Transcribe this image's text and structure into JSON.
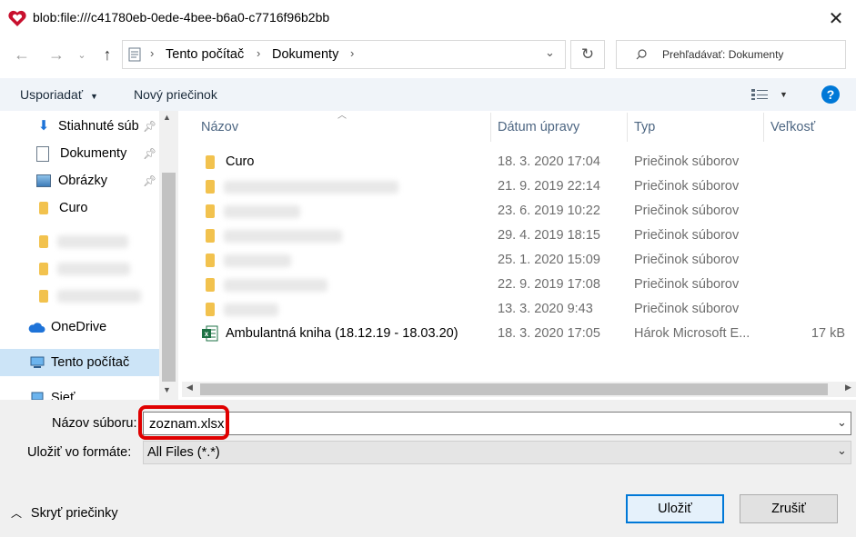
{
  "window": {
    "title": "blob:file:///c41780eb-0ede-4bee-b6a0-c7716f96b2bb"
  },
  "nav": {
    "breadcrumb": [
      "Tento počítač",
      "Dokumenty"
    ],
    "search_placeholder": "Prehľadávať: Dokumenty"
  },
  "toolbar": {
    "organize_label": "Usporiadať",
    "new_folder_label": "Nový priečinok"
  },
  "sidebar": {
    "items": [
      {
        "label": "Stiahnuté súb",
        "icon": "download-icon",
        "pinned": true
      },
      {
        "label": "Dokumenty",
        "icon": "document-icon",
        "pinned": true
      },
      {
        "label": "Obrázky",
        "icon": "picture-icon",
        "pinned": true
      },
      {
        "label": "Curo",
        "icon": "folder-icon",
        "pinned": false
      },
      {
        "label": "OneDrive",
        "icon": "cloud-icon"
      },
      {
        "label": "Tento počítač",
        "icon": "computer-icon",
        "selected": true
      },
      {
        "label": "Sieť",
        "icon": "network-icon"
      }
    ]
  },
  "columns": [
    "Názov",
    "Dátum úpravy",
    "Typ",
    "Veľkosť"
  ],
  "files": [
    {
      "name": "Curo",
      "date": "18. 3. 2020 17:04",
      "type": "Priečinok súborov",
      "size": "",
      "kind": "folder"
    },
    {
      "name": "",
      "date": "21. 9. 2019 22:14",
      "type": "Priečinok súborov",
      "size": "",
      "kind": "folder"
    },
    {
      "name": "",
      "date": "23. 6. 2019 10:22",
      "type": "Priečinok súborov",
      "size": "",
      "kind": "folder"
    },
    {
      "name": "",
      "date": "29. 4. 2019 18:15",
      "type": "Priečinok súborov",
      "size": "",
      "kind": "folder"
    },
    {
      "name": "",
      "date": "25. 1. 2020 15:09",
      "type": "Priečinok súborov",
      "size": "",
      "kind": "folder"
    },
    {
      "name": "",
      "date": "22. 9. 2019 17:08",
      "type": "Priečinok súborov",
      "size": "",
      "kind": "folder"
    },
    {
      "name": "",
      "date": "13. 3. 2020 9:43",
      "type": "Priečinok súborov",
      "size": "",
      "kind": "folder"
    },
    {
      "name": "Ambulantná kniha (18.12.19 - 18.03.20)",
      "date": "18. 3. 2020 17:05",
      "type": "Hárok Microsoft E...",
      "size": "17 kB",
      "kind": "excel"
    }
  ],
  "save_form": {
    "filename_label": "Názov súboru:",
    "filename_value": "zoznam.xlsx",
    "format_label": "Uložiť vo formáte:",
    "format_value": "All Files (*.*)"
  },
  "footer": {
    "hide_folders_label": "Skryť priečinky",
    "save_button": "Uložiť",
    "cancel_button": "Zrušiť"
  },
  "colors": {
    "accent": "#0078d7",
    "highlight": "#e00000",
    "folder": "#f2c24e",
    "excel": "#1d7244"
  }
}
